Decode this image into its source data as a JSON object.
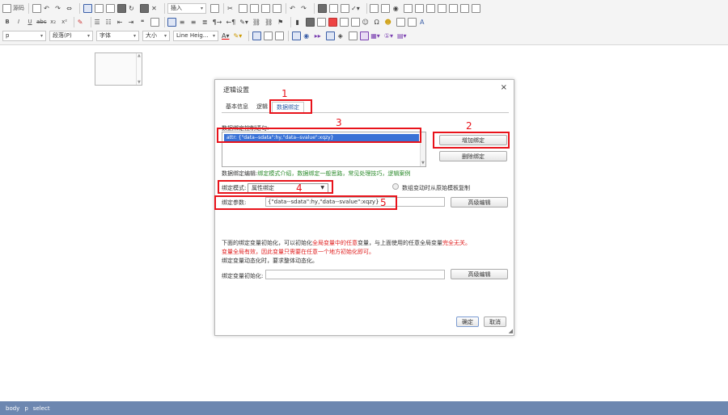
{
  "toolbar": {
    "row1": {
      "source_label": "源码",
      "insert_combo": "插入"
    },
    "row2": {
      "bold": "B",
      "italic": "I",
      "underline": "U",
      "strike": "abc",
      "subscript": "x₂",
      "superscript": "x²"
    },
    "row3": {
      "block_combo": "p",
      "paragraph_combo": "段落(P)",
      "font_combo": "字体",
      "size_combo": "大小",
      "lineheight_combo": "Line Heig..."
    }
  },
  "statusbar": {
    "items": [
      "body",
      "p",
      "select"
    ]
  },
  "dialog": {
    "title": "逻辑设置",
    "close_glyph": "×",
    "tabs": [
      "基本信息",
      "逻辑",
      "数据绑定"
    ],
    "active_tab": 2,
    "binding_list_label": "数据绑定控制语句:",
    "binding_list_items": [
      "attr: {\"data--sdata\":hy,\"data--svalue\":xqzy}"
    ],
    "add_binding_button": "增加绑定",
    "remove_binding_button": "删除绑定",
    "edit_prefix": "数据绑定编辑:",
    "edit_links": [
      "绑定模式介绍",
      "数据绑定一般思路",
      "常见处理技巧",
      "逻辑案例"
    ],
    "edit_links_sep": "，",
    "mode_label": "绑定模式:",
    "mode_value": "属性绑定",
    "copy_checkbox_label": "数组变动时从原始模板复制",
    "param_label": "绑定参数:",
    "param_value": "{\"data--sdata\":hy,\"data--svalue\":xqzy}",
    "advanced_edit_button": "高级编辑",
    "info_line1_a": "下面的绑定变量初始化，可以初始化",
    "info_line1_b": "全局变量中的任意",
    "info_line1_c": "变量，与上面使用的任意全局变量",
    "info_line1_d": "完全无关。",
    "info_line2": "变量全局有效，因此变量只需要在任意一个地方初始化即可。",
    "info_line3": "绑定变量动态化时，要求整体动态化。",
    "init_label": "绑定变量初始化:",
    "init_value": "",
    "advanced_edit_button_2": "高级编辑",
    "ok_button": "确定",
    "cancel_button": "取消"
  },
  "annotations": [
    "1",
    "2",
    "3",
    "4",
    "5"
  ],
  "colors": {
    "annotation_red": "#e8131b",
    "statusbar_blue": "#6d87b0",
    "selection_blue": "#3a72d6",
    "link_green": "#2a8a2a",
    "warn_red": "#e02020"
  }
}
